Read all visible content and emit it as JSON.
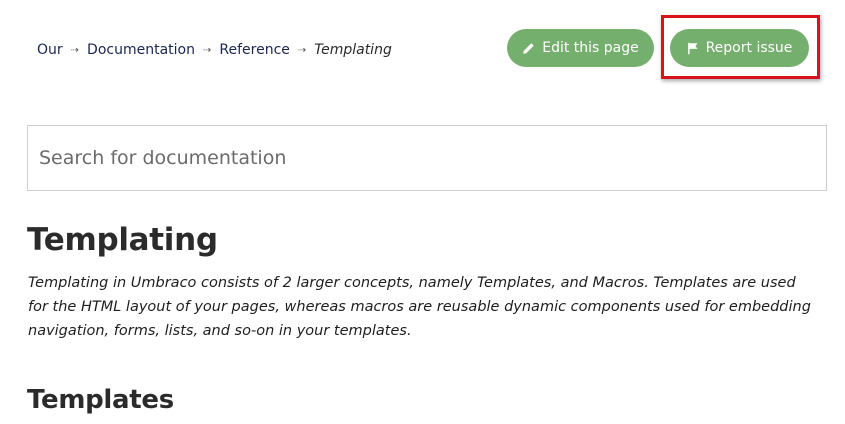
{
  "breadcrumb": {
    "items": [
      "Our",
      "Documentation",
      "Reference"
    ],
    "current": "Templating",
    "separator": "⇢"
  },
  "actions": {
    "edit_label": "Edit this page",
    "edit_icon": "pencil-icon",
    "report_label": "Report issue",
    "report_icon": "flag-icon",
    "button_color": "#75af6d",
    "highlight_color": "#d8141a"
  },
  "search": {
    "placeholder": "Search for documentation",
    "value": ""
  },
  "main": {
    "title": "Templating",
    "intro": "Templating in Umbraco consists of 2 larger concepts, namely Templates, and Macros. Templates are used for the HTML layout of your pages, whereas macros are reusable dynamic components used for embedding navigation, forms, lists, and so-on in your templates.",
    "section_heading": "Templates"
  }
}
